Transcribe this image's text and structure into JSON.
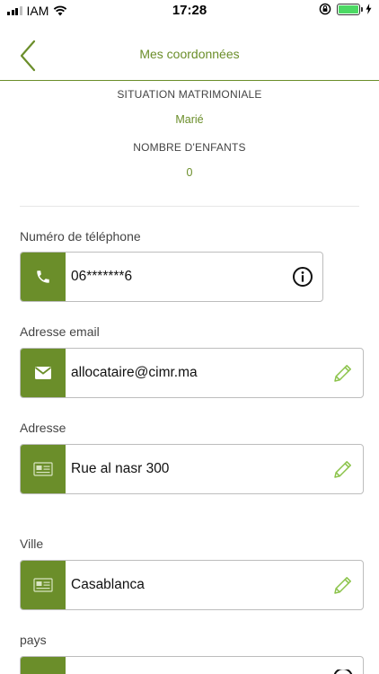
{
  "status_bar": {
    "carrier": "IAM",
    "time": "17:28"
  },
  "header": {
    "title": "Mes coordonnées"
  },
  "info": {
    "marital_label": "SITUATION MATRIMONIALE",
    "marital_value": "Marié",
    "children_label": "NOMBRE D'ENFANTS",
    "children_value": "0"
  },
  "fields": {
    "phone": {
      "label": "Numéro de téléphone",
      "value": "06*******6",
      "icon": "phone-icon",
      "action_icon": "info-icon"
    },
    "email": {
      "label": "Adresse email",
      "value": "allocataire@cimr.ma",
      "icon": "mail-icon",
      "action_icon": "pencil-icon"
    },
    "address": {
      "label": "Adresse",
      "value": "Rue al nasr 300",
      "icon": "address-card-icon",
      "action_icon": "pencil-icon"
    },
    "city": {
      "label": "Ville",
      "value": "Casablanca",
      "icon": "address-card-icon",
      "action_icon": "pencil-icon"
    },
    "country": {
      "label": "pays",
      "icon": "address-card-icon",
      "action_icon": "info-icon"
    }
  },
  "colors": {
    "accent": "#6b8e2a",
    "edit_icon": "#8bc34a"
  }
}
